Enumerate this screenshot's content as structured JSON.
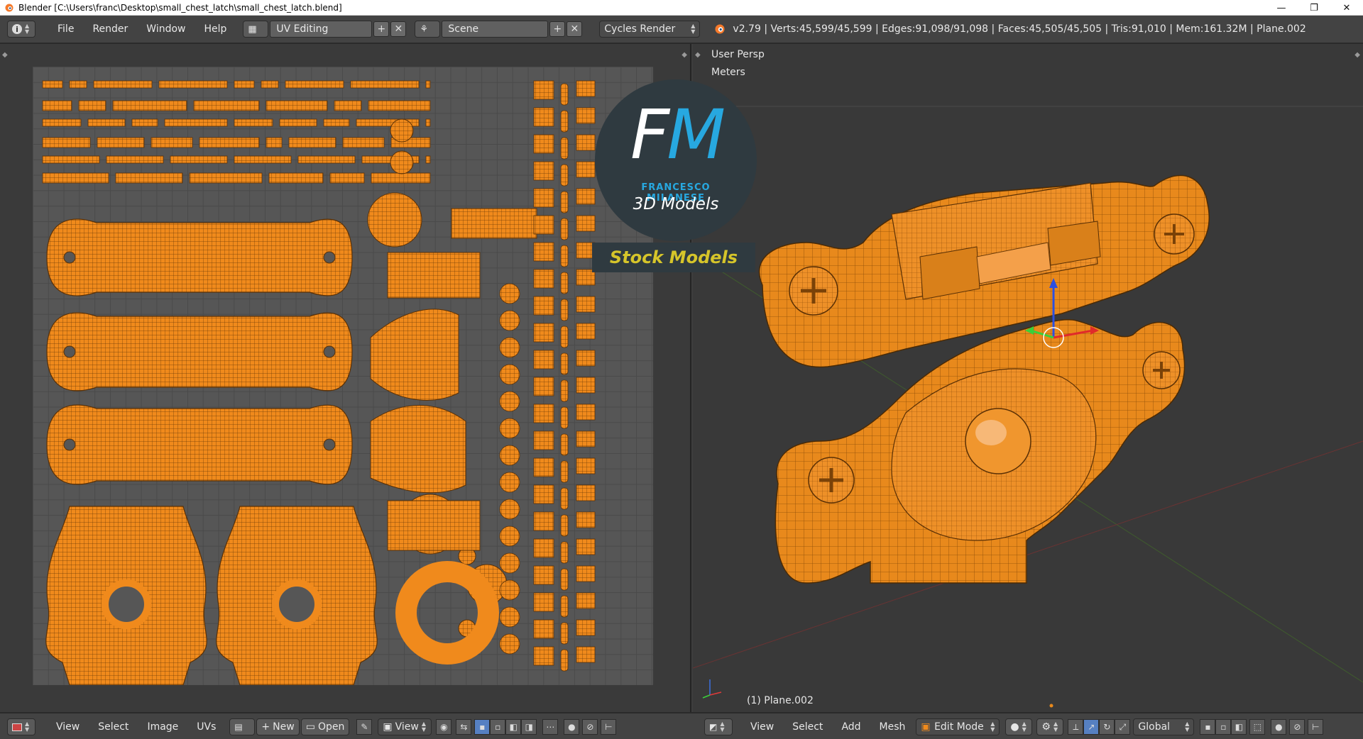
{
  "window": {
    "title": "Blender [C:\\Users\\franc\\Desktop\\small_chest_latch\\small_chest_latch.blend]",
    "controls": [
      "—",
      "❐",
      "✕"
    ]
  },
  "topbar": {
    "menus": [
      "File",
      "Render",
      "Window",
      "Help"
    ],
    "layout_name": "UV Editing",
    "scene_name": "Scene",
    "render_engine": "Cycles Render",
    "stats": "v2.79 | Verts:45,599/45,599 | Edges:91,098/91,098 | Faces:45,505/45,505 | Tris:91,010 | Mem:161.32M | Plane.002"
  },
  "viewport": {
    "view_label": "User Persp",
    "units_label": "Meters",
    "object_label": "(1) Plane.002"
  },
  "watermark": {
    "initial_f": "F",
    "initial_m": "M",
    "name": "FRANCESCO MILANESE",
    "subtitle": "3D Models",
    "banner": "Stock Models"
  },
  "uv_footer": {
    "menus": [
      "View",
      "Select",
      "Image",
      "UVs"
    ],
    "new_label": "New",
    "open_label": "Open",
    "view_label": "View"
  },
  "view3d_footer": {
    "menus": [
      "View",
      "Select",
      "Add",
      "Mesh"
    ],
    "mode": "Edit Mode",
    "orientation": "Global"
  },
  "colors": {
    "accent_orange": "#f08a1c",
    "panel_dark": "#434343",
    "watermark_blue": "#27a8e0",
    "watermark_yellow": "#d6c52a"
  }
}
